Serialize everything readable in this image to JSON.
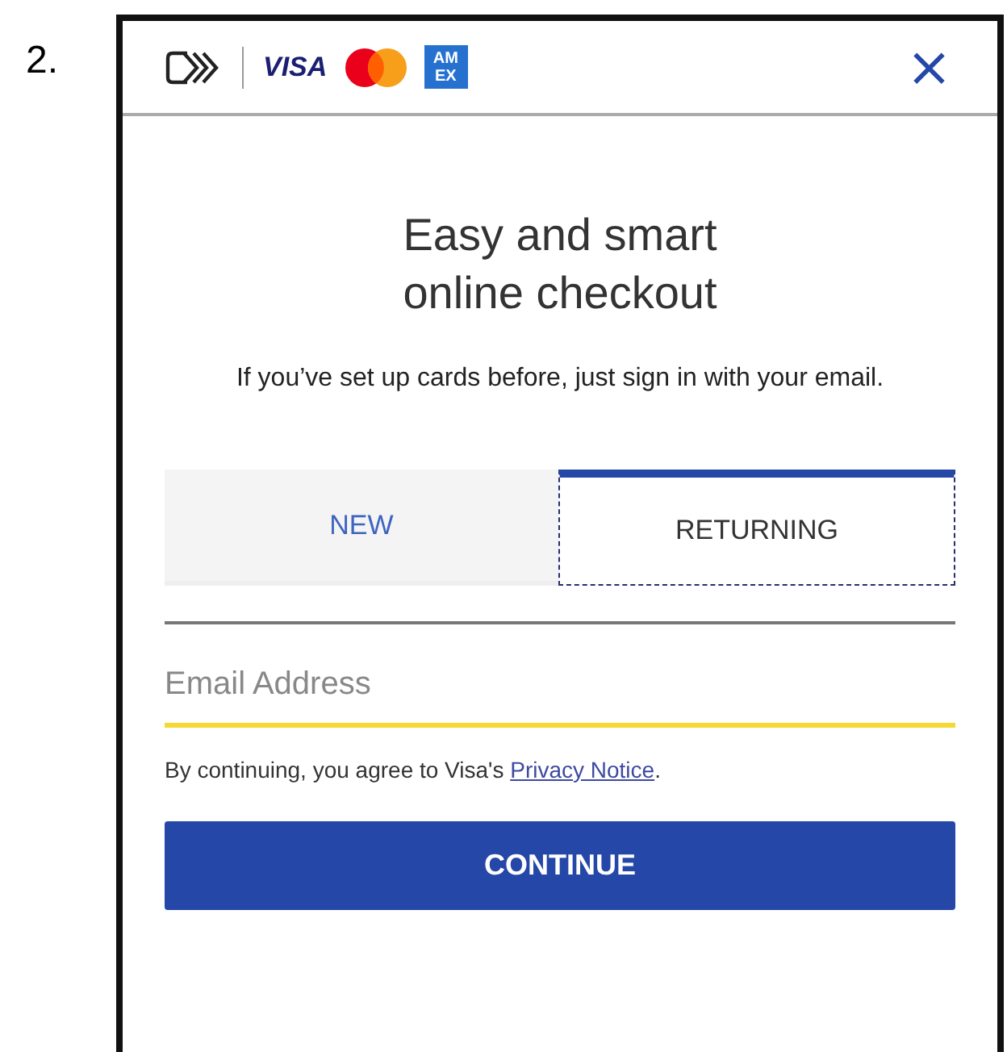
{
  "step_number": "2.",
  "header": {
    "brands": [
      {
        "kind": "click-to-pay"
      },
      {
        "kind": "visa",
        "text": "VISA"
      },
      {
        "kind": "mastercard"
      },
      {
        "kind": "amex",
        "lines": [
          "AM",
          "EX"
        ]
      }
    ],
    "close": "×"
  },
  "title_lines": [
    "Easy and smart",
    "online checkout"
  ],
  "subtitle": "If you’ve set up cards before, just sign in with your email.",
  "tabs": [
    {
      "label": "NEW",
      "selected": false
    },
    {
      "label": "RETURNING",
      "selected": true
    }
  ],
  "email": {
    "placeholder": "Email Address"
  },
  "consent": {
    "text": "By continuing, you agree to Visa's ",
    "link": "Privacy Notice",
    "end": "."
  },
  "button": "CONTINUE"
}
